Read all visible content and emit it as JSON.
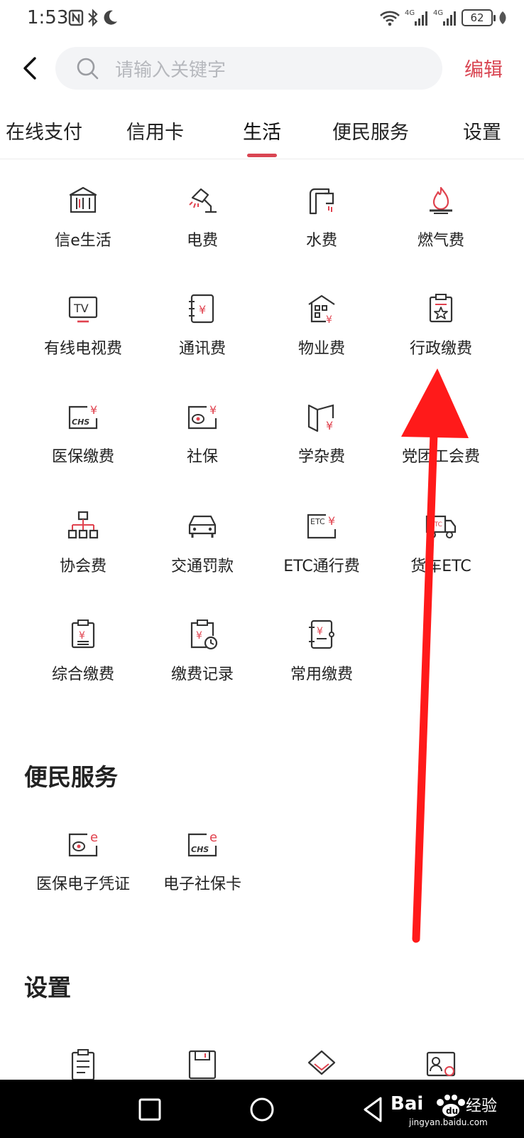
{
  "status": {
    "time": "1:53",
    "battery": "62",
    "net_1": "4G",
    "net_2": "4G"
  },
  "search": {
    "placeholder": "请输入关键字",
    "edit_label": "编辑"
  },
  "tabs": [
    {
      "label": "在线支付"
    },
    {
      "label": "信用卡"
    },
    {
      "label": "生活"
    },
    {
      "label": "便民服务"
    },
    {
      "label": "设置"
    }
  ],
  "life": {
    "items": [
      {
        "label": "信e生活",
        "icon": "bank-icon"
      },
      {
        "label": "电费",
        "icon": "lamp-icon"
      },
      {
        "label": "水费",
        "icon": "faucet-icon"
      },
      {
        "label": "燃气费",
        "icon": "flame-icon"
      },
      {
        "label": "有线电视费",
        "icon": "tv-icon"
      },
      {
        "label": "通讯费",
        "icon": "phone-bill-icon"
      },
      {
        "label": "物业费",
        "icon": "building-icon"
      },
      {
        "label": "行政缴费",
        "icon": "clipboard-star-icon"
      },
      {
        "label": "医保缴费",
        "icon": "chs-card-icon"
      },
      {
        "label": "社保",
        "icon": "social-security-icon"
      },
      {
        "label": "学杂费",
        "icon": "book-icon"
      },
      {
        "label": "党团工会费",
        "icon": "flag-icon"
      },
      {
        "label": "协会费",
        "icon": "org-chart-icon"
      },
      {
        "label": "交通罚款",
        "icon": "car-icon"
      },
      {
        "label": "ETC通行费",
        "icon": "etc-card-icon"
      },
      {
        "label": "货车ETC",
        "icon": "truck-icon"
      },
      {
        "label": "综合缴费",
        "icon": "bill-icon"
      },
      {
        "label": "缴费记录",
        "icon": "bill-clock-icon"
      },
      {
        "label": "常用缴费",
        "icon": "notebook-icon"
      }
    ]
  },
  "convenience": {
    "title": "便民服务",
    "items": [
      {
        "label": "医保电子凭证",
        "icon": "e-voucher-icon"
      },
      {
        "label": "电子社保卡",
        "icon": "e-chs-card-icon"
      }
    ]
  },
  "settings": {
    "title": "设置"
  },
  "watermark": {
    "brand": "Bai",
    "brand_2": "du",
    "text": "经验",
    "site": "jingyan.baidu.com"
  },
  "colors": {
    "accent": "#d94552",
    "icon_stroke": "#333333",
    "icon_accent": "#e0424e"
  }
}
